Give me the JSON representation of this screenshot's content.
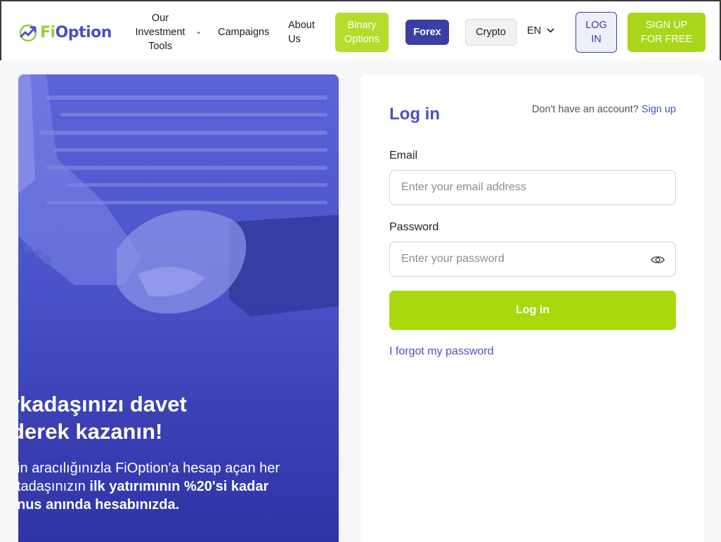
{
  "header": {
    "logo": {
      "fi": "Fi",
      "option": "Option"
    },
    "nav": {
      "tools": "Our\nInvestment\nTools",
      "campaigns": "Campaigns",
      "about": "About\nUs"
    },
    "pills": {
      "binary": "Binary\nOptions",
      "forex": "Forex",
      "crypto": "Crypto"
    },
    "language": "EN",
    "login": "LOG\nIN",
    "signup": "SIGN UP\nFOR FREE"
  },
  "promo": {
    "title": "rkadaşınızı davet\nderek kazanın!",
    "body_plain": "in aracılığınızla FiOption'a hesap açan her\ntadaşınızın ",
    "body_bold": "ilk yatırımının %20'si kadar\nnus anında hesabınızda."
  },
  "login_form": {
    "title": "Log in",
    "no_account": "Don't have an account?",
    "signup_link": "Sign up",
    "email_label": "Email",
    "email_placeholder": "Enter your email address",
    "password_label": "Password",
    "password_placeholder": "Enter your password",
    "submit": "Log in",
    "forgot": "I forgot my password"
  },
  "colors": {
    "brand_purple": "#4a4fc7",
    "brand_green": "#a9d90d",
    "forex_pill": "#3c3ea3",
    "binary_pill": "#b5dc2a"
  },
  "icons": [
    "logo-chart-icon",
    "chevron-down-icon",
    "eye-icon"
  ]
}
